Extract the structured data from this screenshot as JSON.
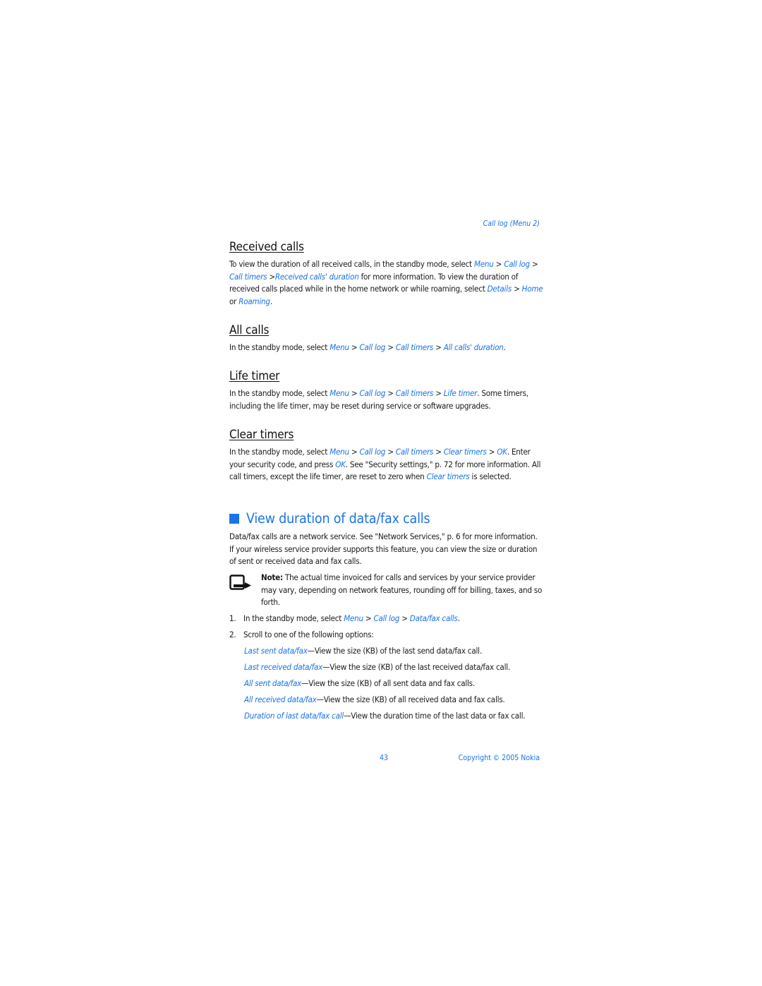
{
  "running_head": "Call log (Menu 2)",
  "sections": {
    "received_calls": {
      "title": "Received calls",
      "p1": "To view the duration of all received calls, in the standby mode, select ",
      "l1": "Menu",
      "s1": " > ",
      "l2": "Call log",
      "s2": " > ",
      "l3": "Call timers",
      "s3": " >",
      "l4": "Received calls' duration",
      "p2": " for more information. To view the duration of received calls placed while in the home network or while roaming, select ",
      "l5": "Details",
      "s4": " > ",
      "l6": "Home",
      "s5": " or ",
      "l7": "Roaming",
      "end": "."
    },
    "all_calls": {
      "title": "All calls",
      "p1": "In the standby mode, select ",
      "l1": "Menu",
      "s1": " > ",
      "l2": "Call log",
      "s2": " > ",
      "l3": "Call timers",
      "s3": " > ",
      "l4": "All calls' duration",
      "end": "."
    },
    "life_timer": {
      "title": "Life timer",
      "p1": "In the standby mode, select ",
      "l1": "Menu",
      "s1": " > ",
      "l2": "Call log",
      "s2": " > ",
      "l3": "Call timers",
      "s3": " > ",
      "l4": "Life timer",
      "p2": ". Some timers, including the life timer, may be reset during service or software upgrades."
    },
    "clear_timers": {
      "title": "Clear timers",
      "p1": "In the standby mode, select ",
      "l1": "Menu",
      "s1": " > ",
      "l2": "Call log",
      "s2": " > ",
      "l3": "Call timers",
      "s3": " > ",
      "l4": "Clear timers",
      "s4": " > ",
      "l5": "OK",
      "p2": ". Enter your security code, and press ",
      "l6": "OK",
      "p3": ". See \"Security settings,\" p. 72 for more information. All call timers, except the life timer, are reset to zero when ",
      "l7": "Clear timers",
      "p4": " is selected."
    }
  },
  "data_fax": {
    "title": "View duration of data/fax calls",
    "intro": "Data/fax calls are a network service. See \"Network Services,\" p. 6 for more information. If your wireless service provider supports this feature, you can view the size or duration of sent or received data and fax calls.",
    "note_label": "Note:",
    "note_text": " The actual time invoiced for calls and services by your service provider may vary, depending on network features, rounding off for billing, taxes, and so forth.",
    "steps": [
      {
        "num": "1.",
        "p1": "In the standby mode, select ",
        "l1": "Menu",
        "s1": " > ",
        "l2": "Call log",
        "s2": " > ",
        "l3": "Data/fax calls",
        "end": "."
      },
      {
        "num": "2.",
        "text": "Scroll to one of the following options:"
      }
    ],
    "options": [
      {
        "name": "Last sent data/fax",
        "desc": "—View the size (KB) of the last send data/fax call."
      },
      {
        "name": "Last received data/fax",
        "desc": "—View the size (KB) of the last received data/fax call."
      },
      {
        "name": "All sent data/fax",
        "desc": "—View the size (KB) of all sent data and fax calls."
      },
      {
        "name": "All received data/fax",
        "desc": "—View the size (KB) of all received data and fax calls."
      },
      {
        "name": "Duration of last data/fax call",
        "desc": "—View the duration time of the last data or fax call."
      }
    ]
  },
  "footer": {
    "page_number": "43",
    "copyright": "Copyright © 2005 Nokia"
  },
  "colors": {
    "link": "#1a73e8",
    "text": "#1a1a1a"
  }
}
